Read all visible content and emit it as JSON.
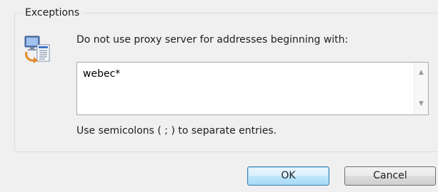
{
  "exceptions": {
    "group_title": "Exceptions",
    "description": "Do not use proxy server for addresses beginning with:",
    "value": "webec*",
    "hint": "Use semicolons ( ; ) to separate entries.",
    "icon": "proxy-computer-icon"
  },
  "buttons": {
    "ok": "OK",
    "cancel": "Cancel"
  },
  "scrollbar": {
    "up_icon": "scroll-up-arrow-icon",
    "down_icon": "scroll-down-arrow-icon"
  },
  "colors": {
    "window_bg": "#f0f0f0",
    "default_button_border": "#3c7fb1"
  }
}
